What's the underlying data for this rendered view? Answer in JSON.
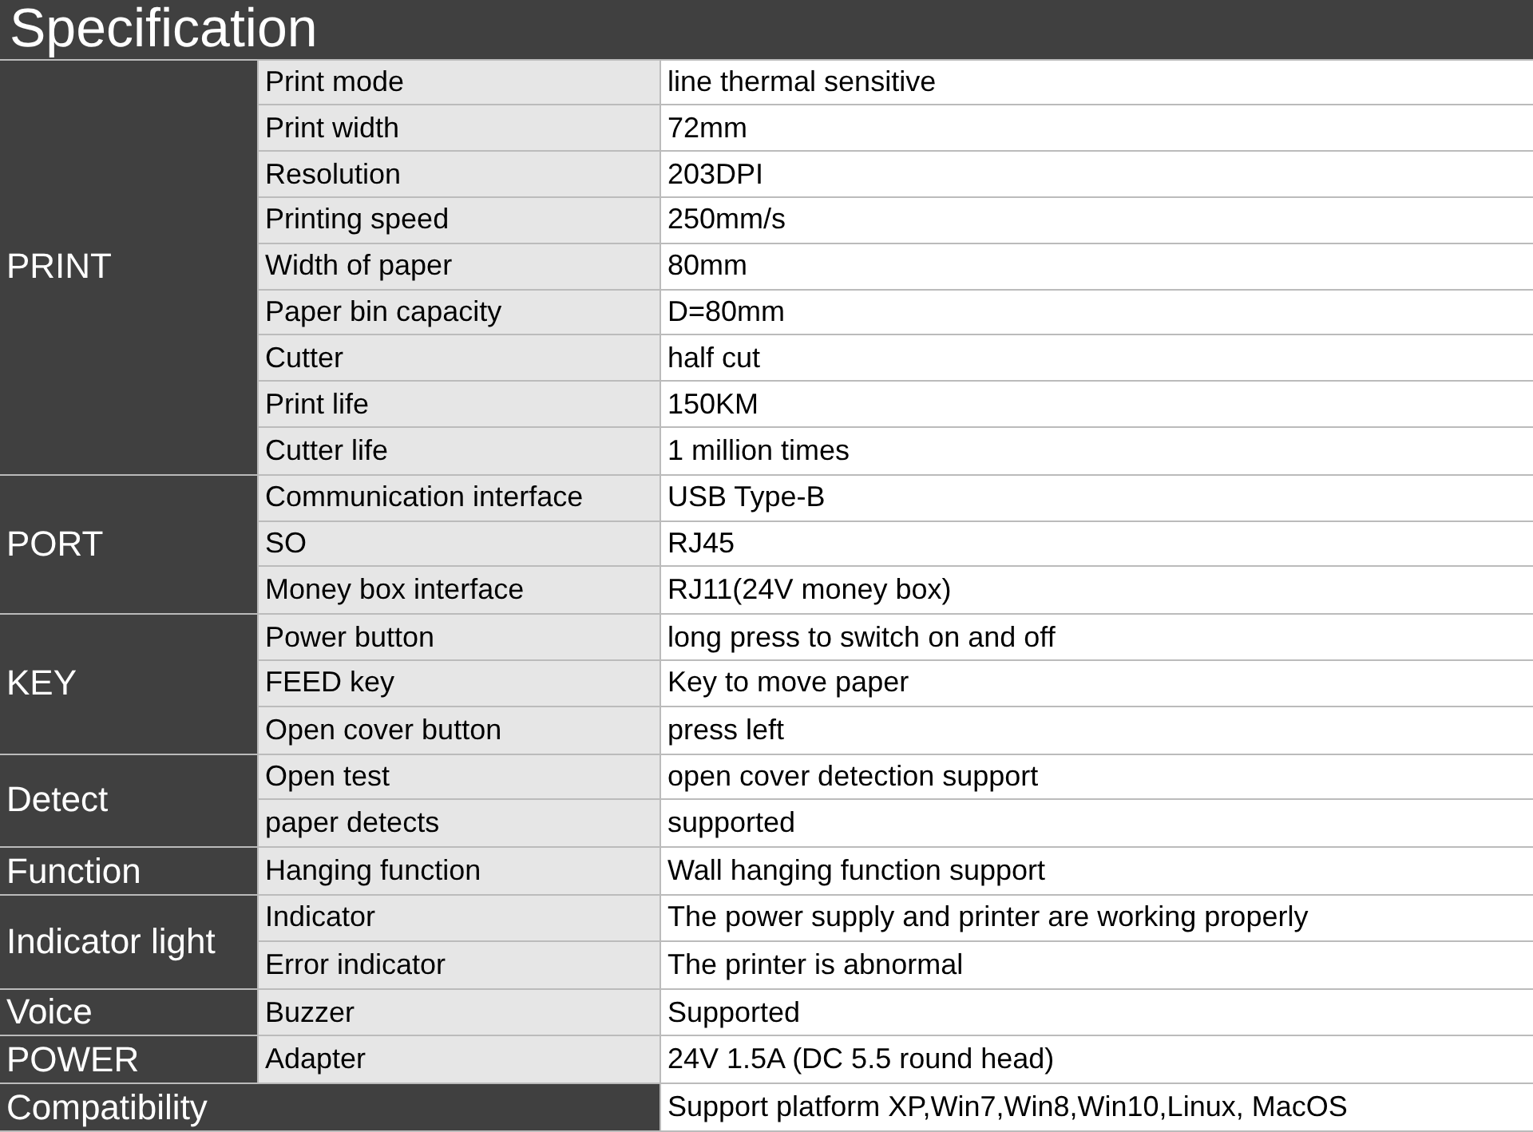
{
  "title": "Specification",
  "groups": [
    {
      "name": "PRINT",
      "rows": [
        {
          "label": "Print mode",
          "value": "line thermal sensitive"
        },
        {
          "label": "Print width",
          "value": "72mm"
        },
        {
          "label": "Resolution",
          "value": "203DPI"
        },
        {
          "label": "Printing speed",
          "value": "250mm/s"
        },
        {
          "label": "Width of paper",
          "value": "80mm"
        },
        {
          "label": "Paper bin capacity",
          "value": "D=80mm"
        },
        {
          "label": "Cutter",
          "value": "half cut"
        },
        {
          "label": "Print life",
          "value": "150KM"
        },
        {
          "label": "Cutter life",
          "value": "1 million times"
        }
      ]
    },
    {
      "name": "PORT",
      "rows": [
        {
          "label": "Communication interface",
          "value": "USB Type-B"
        },
        {
          "label": "SO",
          "value": "RJ45"
        },
        {
          "label": "Money box interface",
          "value": "RJ11(24V money box)"
        }
      ]
    },
    {
      "name": "KEY",
      "rows": [
        {
          "label": "Power button",
          "value": "long press to switch on and off"
        },
        {
          "label": "FEED key",
          "value": "Key to move paper"
        },
        {
          "label": "Open cover button",
          "value": "press left"
        }
      ]
    },
    {
      "name": "Detect",
      "rows": [
        {
          "label": "Open test",
          "value": "open cover detection support"
        },
        {
          "label": "paper detects",
          "value": "supported"
        }
      ]
    },
    {
      "name": "Function",
      "rows": [
        {
          "label": "Hanging function",
          "value": "Wall hanging function support"
        }
      ]
    },
    {
      "name": "Indicator light",
      "rows": [
        {
          "label": "Indicator",
          "value": "The power supply and printer are working properly"
        },
        {
          "label": "Error indicator",
          "value": "The printer is abnormal"
        }
      ]
    },
    {
      "name": "Voice",
      "rows": [
        {
          "label": "Buzzer",
          "value": "Supported"
        }
      ]
    },
    {
      "name": "POWER",
      "rows": [
        {
          "label": "Adapter",
          "value": "24V 1.5A (DC 5.5 round head)"
        }
      ]
    },
    {
      "name": "Compatibility",
      "rows": [
        {
          "value": "Support platform XP,Win7,Win8,Win10,Linux, MacOS"
        }
      ]
    }
  ]
}
